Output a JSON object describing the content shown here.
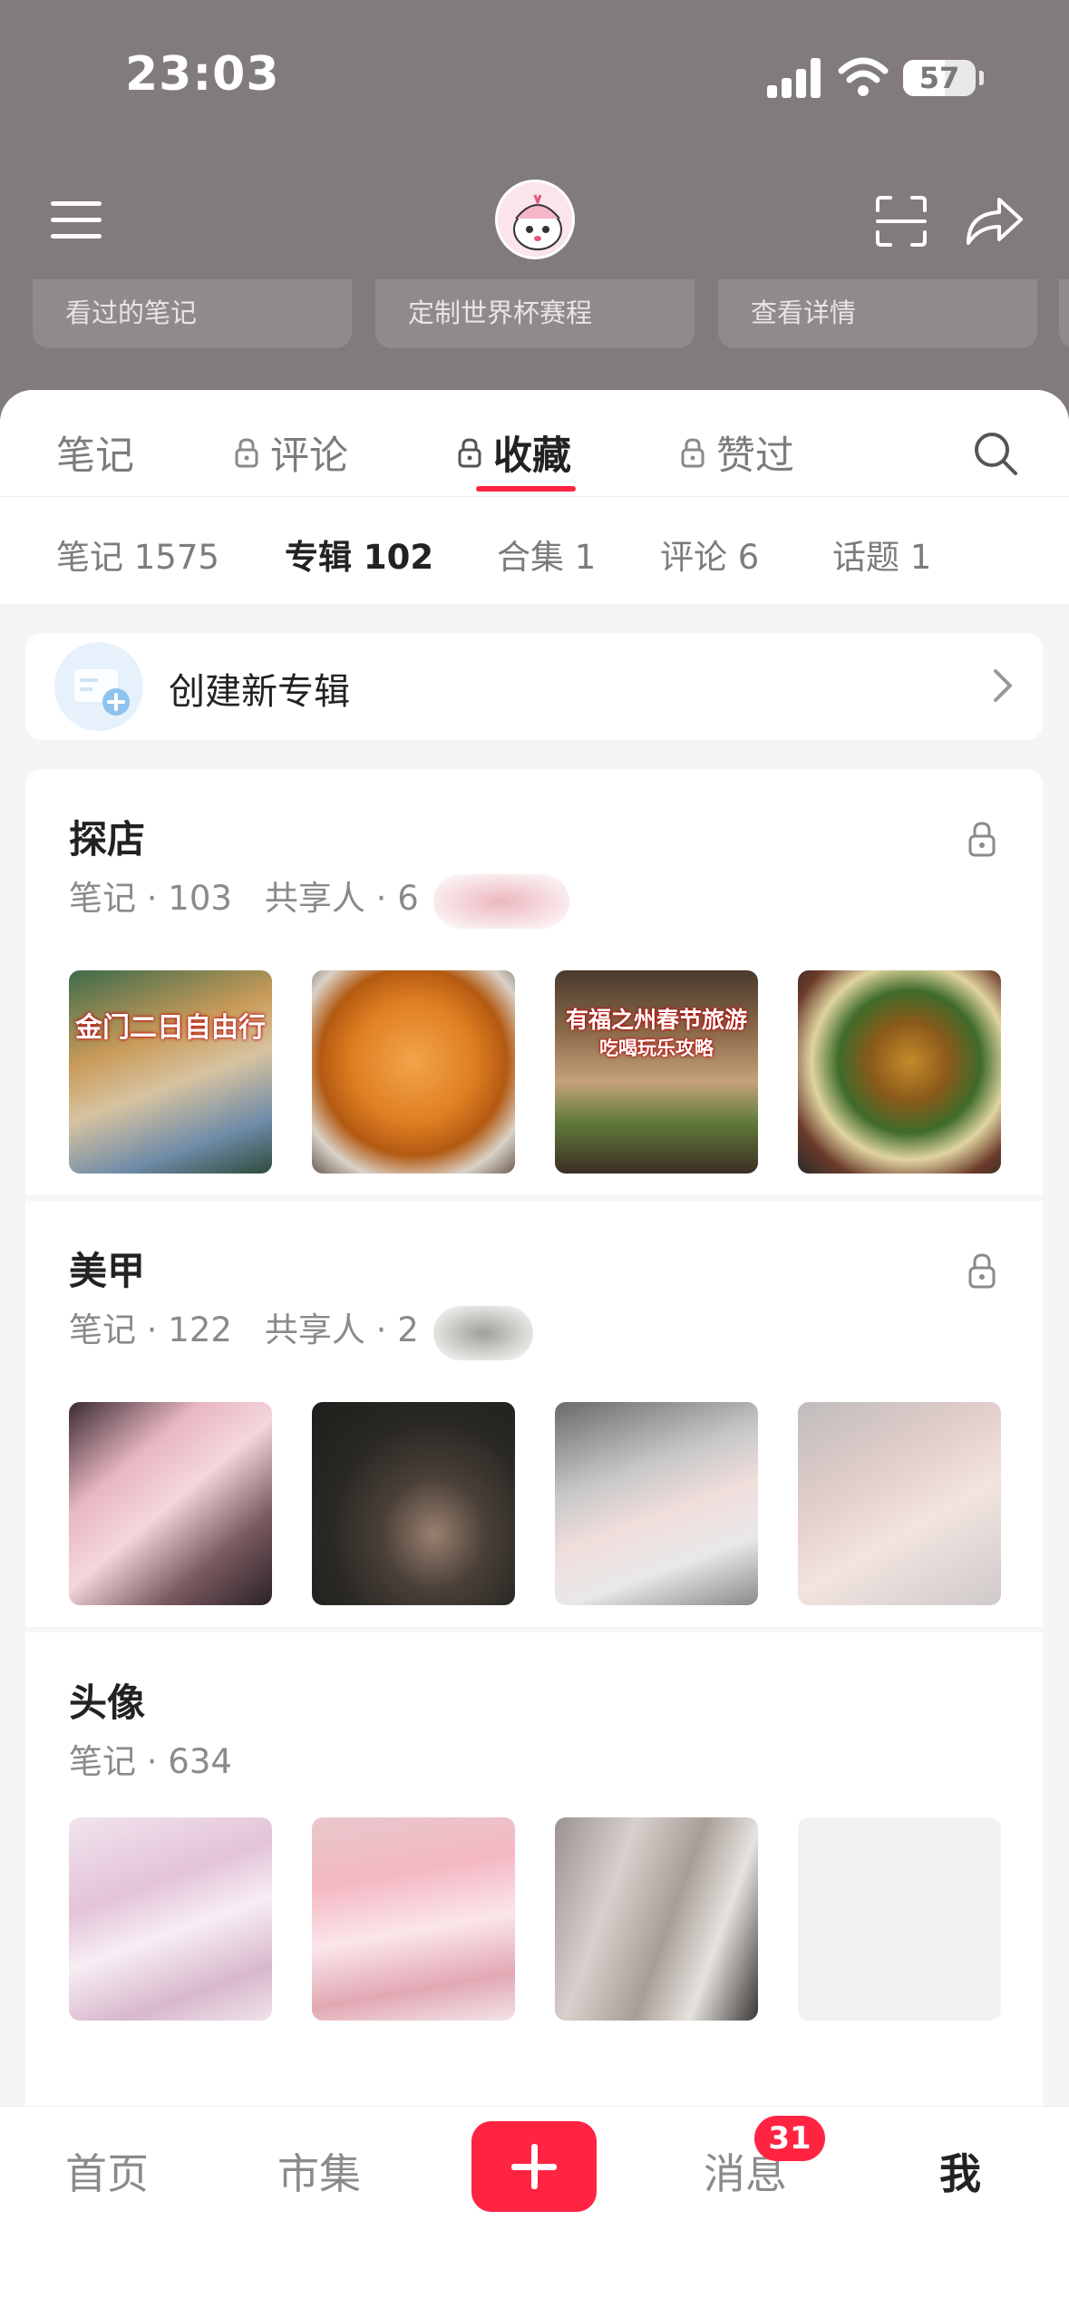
{
  "status_bar": {
    "time": "23:03",
    "battery": "57",
    "battery_level": 0.57
  },
  "header": {
    "menu_icon": "hamburger-menu-icon",
    "avatar": "user-avatar",
    "scan_icon": "scan-icon",
    "share_icon": "share-icon"
  },
  "quick_cards": [
    {
      "label": "看过的笔记"
    },
    {
      "label": "定制世界杯赛程"
    },
    {
      "label": "查看详情"
    }
  ],
  "tabs": [
    {
      "label": "笔记",
      "locked": false,
      "active": false
    },
    {
      "label": "评论",
      "locked": true,
      "active": false
    },
    {
      "label": "收藏",
      "locked": true,
      "active": true
    },
    {
      "label": "赞过",
      "locked": true,
      "active": false
    }
  ],
  "subtabs": [
    {
      "label": "笔记 1575",
      "active": false
    },
    {
      "label": "专辑 102",
      "active": true
    },
    {
      "label": "合集 1",
      "active": false
    },
    {
      "label": "评论 6",
      "active": false
    },
    {
      "label": "话题 1",
      "active": false
    }
  ],
  "create_album": {
    "label": "创建新专辑"
  },
  "albums": [
    {
      "title": "探店",
      "notes": "笔记 · 103",
      "sharers": "共享人 · 6",
      "locked": true,
      "thumb_captions": [
        [
          "金门二日自由行"
        ],
        [],
        [
          "有福之州春节旅游",
          "吃喝玩乐攻略"
        ],
        []
      ]
    },
    {
      "title": "美甲",
      "notes": "笔记 · 122",
      "sharers": "共享人 · 2",
      "locked": true
    },
    {
      "title": "头像",
      "notes": "笔记 · 634",
      "sharers": "",
      "locked": false
    }
  ],
  "bottom_nav": [
    {
      "label": "首页",
      "active": false
    },
    {
      "label": "市集",
      "active": false
    },
    {
      "label": "消息",
      "active": false
    },
    {
      "label": "我",
      "active": true
    }
  ],
  "messages_badge": "31",
  "colors": {
    "accent": "#ff2442",
    "header_bg": "#817b7c",
    "page_bg": "#f5f5f5"
  }
}
